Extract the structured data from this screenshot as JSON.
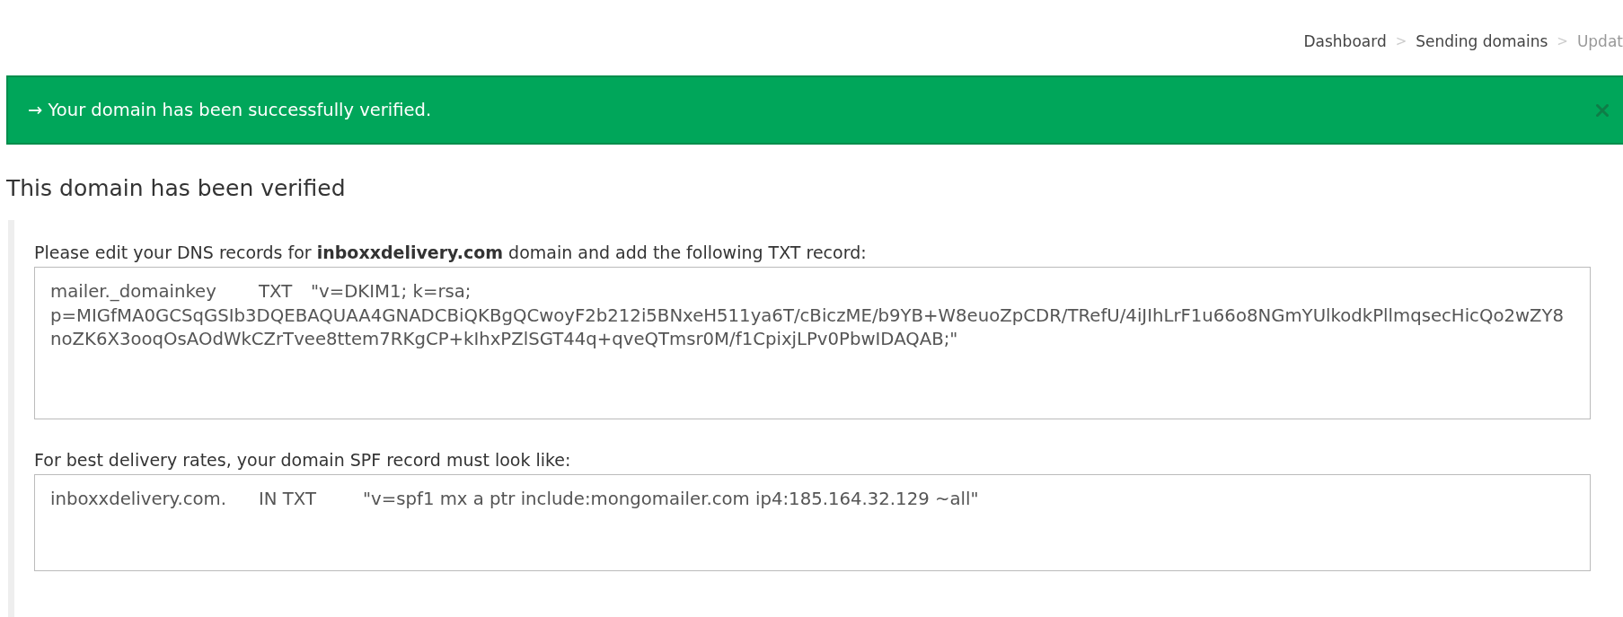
{
  "breadcrumb": {
    "separator": ">",
    "items": [
      {
        "label": "Dashboard",
        "current": false
      },
      {
        "label": "Sending domains",
        "current": false
      },
      {
        "label": "Updat",
        "current": true
      }
    ]
  },
  "alert": {
    "text": "→ Your domain has been successfully verified.",
    "dismissible": true
  },
  "heading": "This domain has been verified",
  "records": [
    {
      "instruction": "Please edit your DNS records for **inboxxdelivery.com** domain and add the following TXT record:",
      "value": "mailer._domainkey\tTXT\t\"v=DKIM1; k=rsa; p=MIGfMA0GCSqGSIb3DQEBAQUAA4GNADCBiQKBgQCwoyF2b212i5BNxeH511ya6T/cBiczME/b9YB+W8euoZpCDR/TRefU/4iJIhLrF1u66o8NGmYUlkodkPllmqsecHicQo2wZY8noZK6X3ooqOsAOdWkCZrTvee8ttem7RKgCP+kIhxPZlSGT44q+qveQTmsr0M/f1CpixjLPv0PbwIDAQAB;\""
    },
    {
      "instruction": "For best delivery rates, your domain SPF record must look like:",
      "value": "inboxxdelivery.com.\tIN TXT\t\"v=spf1 mx a ptr include:mongomailer.com ip4:185.164.32.129 ~all\""
    }
  ]
}
